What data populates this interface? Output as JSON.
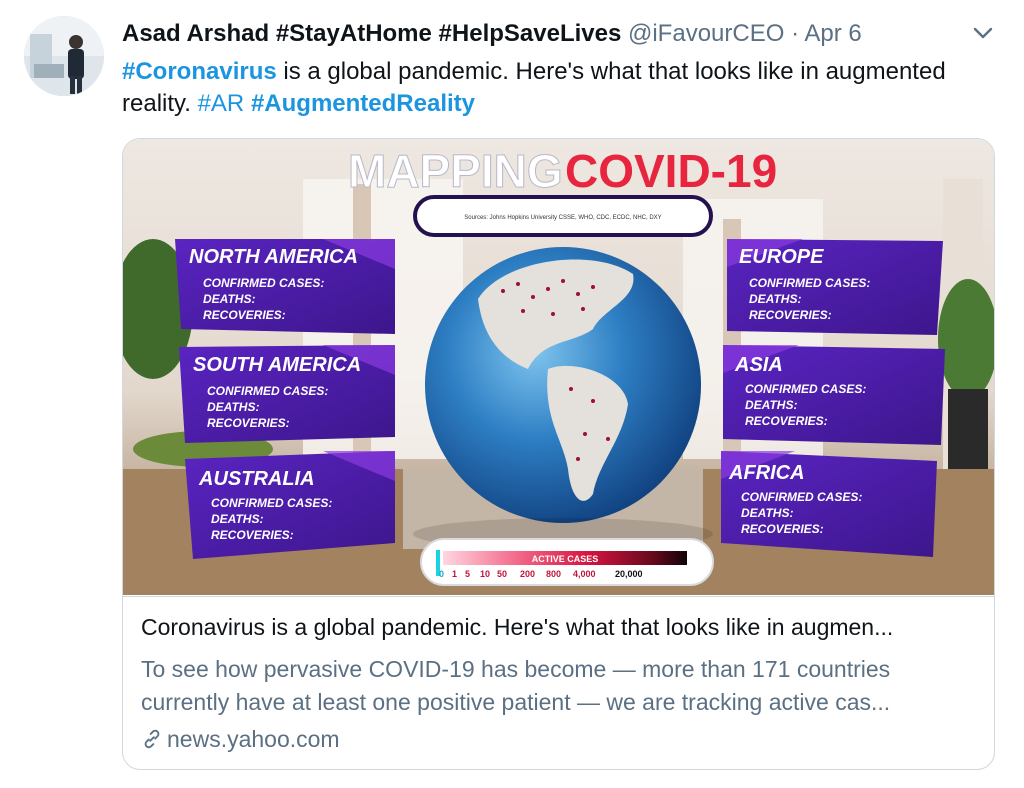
{
  "author": {
    "name": "Asad Arshad #StayAtHome #HelpSaveLives",
    "handle": "@iFavourCEO",
    "separator": "·",
    "date": "Apr 6"
  },
  "tweet": {
    "parts": [
      {
        "text": "#Coronavirus",
        "type": "hashtag-bold"
      },
      {
        "text": " is a global pandemic. Here's what that looks like in augmented reality. ",
        "type": "text"
      },
      {
        "text": "#AR",
        "type": "hashtag"
      },
      {
        "text": " ",
        "type": "text"
      },
      {
        "text": "#AugmentedReality",
        "type": "hashtag-bold"
      }
    ]
  },
  "media": {
    "title_part1": "MAPPING",
    "title_part2": "COVID-19",
    "sources": "Sources: Johns Hopkins University CSSE, WHO, CDC, ECDC, NHC, DXY",
    "row_labels": [
      "CONFIRMED CASES:",
      "DEATHS:",
      "RECOVERIES:"
    ],
    "regions": {
      "north_america": "NORTH AMERICA",
      "south_america": "SOUTH AMERICA",
      "australia": "AUSTRALIA",
      "europe": "EUROPE",
      "asia": "ASIA",
      "africa": "AFRICA"
    },
    "legend_title": "ACTIVE CASES",
    "legend_ticks": [
      "0",
      "1",
      "5",
      "10",
      "50",
      "200",
      "800",
      "4,000",
      "20,000"
    ]
  },
  "card": {
    "title": "Coronavirus is a global pandemic. Here's what that looks like in augmen...",
    "description": "To see how pervasive COVID-19 has become — more than 171 countries currently have at least one positive patient — we are tracking active cas...",
    "source": "news.yahoo.com"
  },
  "colors": {
    "hashtag": "#1b95e0",
    "panel": "#4b1fa6",
    "covid_red": "#e8253f"
  },
  "icons": [
    "chevron-down-icon",
    "link-icon"
  ]
}
